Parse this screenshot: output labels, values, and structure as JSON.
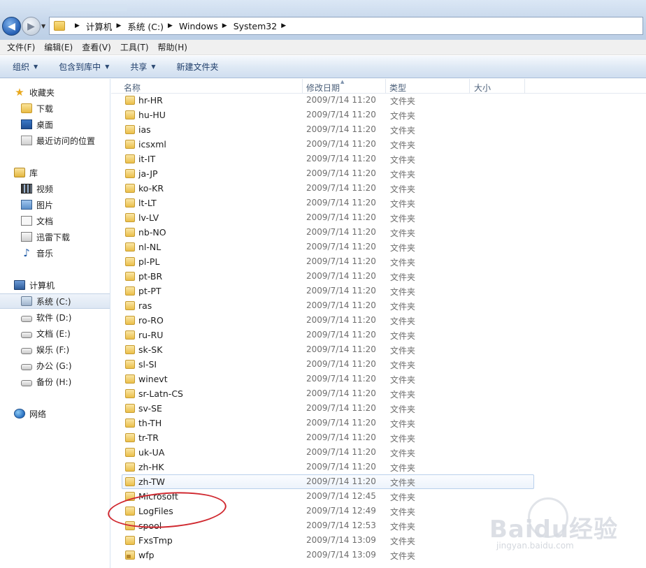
{
  "addressbar": {
    "crumbs": [
      "计算机",
      "系统 (C:)",
      "Windows",
      "System32"
    ]
  },
  "menubar": {
    "items": [
      "文件(F)",
      "编辑(E)",
      "查看(V)",
      "工具(T)",
      "帮助(H)"
    ]
  },
  "commandbar": {
    "organize": "组织",
    "include": "包含到库中",
    "share": "共享",
    "new_folder": "新建文件夹"
  },
  "navpane": {
    "favorites": {
      "label": "收藏夹",
      "items": [
        "下载",
        "桌面",
        "最近访问的位置"
      ]
    },
    "libraries": {
      "label": "库",
      "items": [
        "视频",
        "图片",
        "文档",
        "迅雷下载",
        "音乐"
      ]
    },
    "computer": {
      "label": "计算机",
      "drives": [
        "系统 (C:)",
        "软件 (D:)",
        "文档 (E:)",
        "娱乐 (F:)",
        "办公 (G:)",
        "备份 (H:)"
      ],
      "selected": "系统 (C:)"
    },
    "network": {
      "label": "网络"
    }
  },
  "filelist": {
    "columns": {
      "name": "名称",
      "date": "修改日期",
      "type": "类型",
      "size": "大小"
    },
    "rows": [
      {
        "name": "hr-HR",
        "date": "2009/7/14 11:20",
        "type": "文件夹"
      },
      {
        "name": "hu-HU",
        "date": "2009/7/14 11:20",
        "type": "文件夹"
      },
      {
        "name": "ias",
        "date": "2009/7/14 11:20",
        "type": "文件夹"
      },
      {
        "name": "icsxml",
        "date": "2009/7/14 11:20",
        "type": "文件夹"
      },
      {
        "name": "it-IT",
        "date": "2009/7/14 11:20",
        "type": "文件夹"
      },
      {
        "name": "ja-JP",
        "date": "2009/7/14 11:20",
        "type": "文件夹"
      },
      {
        "name": "ko-KR",
        "date": "2009/7/14 11:20",
        "type": "文件夹"
      },
      {
        "name": "lt-LT",
        "date": "2009/7/14 11:20",
        "type": "文件夹"
      },
      {
        "name": "lv-LV",
        "date": "2009/7/14 11:20",
        "type": "文件夹"
      },
      {
        "name": "nb-NO",
        "date": "2009/7/14 11:20",
        "type": "文件夹"
      },
      {
        "name": "nl-NL",
        "date": "2009/7/14 11:20",
        "type": "文件夹"
      },
      {
        "name": "pl-PL",
        "date": "2009/7/14 11:20",
        "type": "文件夹"
      },
      {
        "name": "pt-BR",
        "date": "2009/7/14 11:20",
        "type": "文件夹"
      },
      {
        "name": "pt-PT",
        "date": "2009/7/14 11:20",
        "type": "文件夹"
      },
      {
        "name": "ras",
        "date": "2009/7/14 11:20",
        "type": "文件夹"
      },
      {
        "name": "ro-RO",
        "date": "2009/7/14 11:20",
        "type": "文件夹"
      },
      {
        "name": "ru-RU",
        "date": "2009/7/14 11:20",
        "type": "文件夹"
      },
      {
        "name": "sk-SK",
        "date": "2009/7/14 11:20",
        "type": "文件夹"
      },
      {
        "name": "sl-SI",
        "date": "2009/7/14 11:20",
        "type": "文件夹"
      },
      {
        "name": "winevt",
        "date": "2009/7/14 11:20",
        "type": "文件夹"
      },
      {
        "name": "sr-Latn-CS",
        "date": "2009/7/14 11:20",
        "type": "文件夹"
      },
      {
        "name": "sv-SE",
        "date": "2009/7/14 11:20",
        "type": "文件夹"
      },
      {
        "name": "th-TH",
        "date": "2009/7/14 11:20",
        "type": "文件夹"
      },
      {
        "name": "tr-TR",
        "date": "2009/7/14 11:20",
        "type": "文件夹"
      },
      {
        "name": "uk-UA",
        "date": "2009/7/14 11:20",
        "type": "文件夹"
      },
      {
        "name": "zh-HK",
        "date": "2009/7/14 11:20",
        "type": "文件夹"
      },
      {
        "name": "zh-TW",
        "date": "2009/7/14 11:20",
        "type": "文件夹"
      },
      {
        "name": "Microsoft",
        "date": "2009/7/14 12:45",
        "type": "文件夹"
      },
      {
        "name": "LogFiles",
        "date": "2009/7/14 12:49",
        "type": "文件夹"
      },
      {
        "name": "spool",
        "date": "2009/7/14 12:53",
        "type": "文件夹"
      },
      {
        "name": "FxsTmp",
        "date": "2009/7/14 13:09",
        "type": "文件夹"
      },
      {
        "name": "wfp",
        "date": "2009/7/14 13:09",
        "type": "文件夹"
      }
    ],
    "hovered_row": "zh-TW",
    "annotated_row": "LogFiles"
  },
  "watermark": {
    "text": "Baidu经验",
    "sub": "jingyan.baidu.com"
  },
  "colors": {
    "annotation": "#d0282f",
    "accent": "#1e3d6a",
    "selection": "#dde7f3"
  }
}
